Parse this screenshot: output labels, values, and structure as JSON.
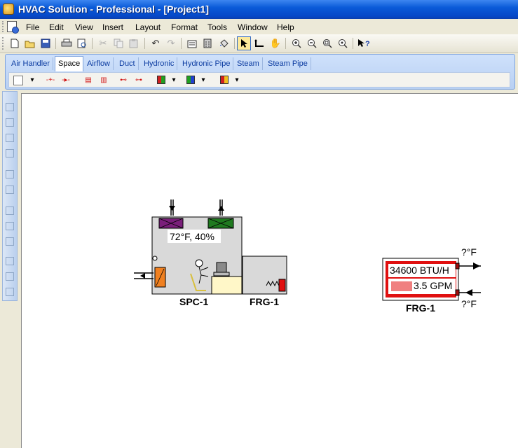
{
  "window": {
    "title": "HVAC Solution - Professional - [Project1]"
  },
  "menu": {
    "items": [
      {
        "label": "File"
      },
      {
        "label": "Edit"
      },
      {
        "label": "View"
      },
      {
        "label": "Insert"
      },
      {
        "label": "Layout"
      },
      {
        "label": "Format"
      },
      {
        "label": "Tools"
      },
      {
        "label": "Window"
      },
      {
        "label": "Help"
      }
    ]
  },
  "tabs": {
    "items": [
      {
        "label": "Air Handler"
      },
      {
        "label": "Space"
      },
      {
        "label": "Airflow"
      },
      {
        "label": "Duct"
      },
      {
        "label": "Hydronic"
      },
      {
        "label": "Hydronic Pipe"
      },
      {
        "label": "Steam"
      },
      {
        "label": "Steam Pipe"
      }
    ],
    "selected": "Space"
  },
  "diagram": {
    "space": {
      "label": "SPC-1",
      "readout": "72°F, 40%"
    },
    "frg_attached": {
      "label": "FRG-1"
    },
    "frg_unit": {
      "label": "FRG-1",
      "capacity": "34600 BTU/H",
      "flow": "3.5 GPM",
      "temp_out": "?°F",
      "temp_in": "?°F"
    }
  },
  "colors": {
    "title_bar": "#0a5ad8",
    "canvas": "#ffffff",
    "space_fill": "#d9d9d9",
    "supply_diffuser": "#7a1f7a",
    "return_diffuser": "#1f7a1f",
    "frg_red": "#e01010",
    "heater_orange": "#f08020",
    "desk": "#fff7c8"
  }
}
